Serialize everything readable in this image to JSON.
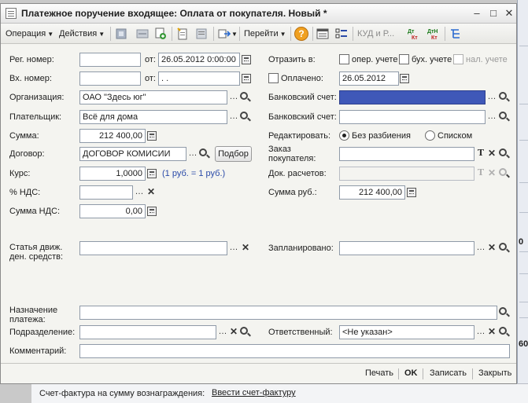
{
  "window": {
    "title": "Платежное поручение входящее: Оплата от покупателя. Новый *",
    "controls": {
      "minimize": "–",
      "maximize": "□",
      "close": "✕"
    }
  },
  "toolbar": {
    "operation": "Операция",
    "actions": "Действия",
    "goto": "Перейти",
    "kud": "КУД и Р...",
    "help": "?"
  },
  "form": {
    "reg_number": {
      "label": "Рег. номер:",
      "value": "",
      "from_label": "от:",
      "date": "26.05.2012  0:00:00"
    },
    "in_number": {
      "label": "Вх. номер:",
      "value": "",
      "from_label": "от:",
      "date": "  .  ."
    },
    "reflect": {
      "label": "Отразить в:",
      "oper": "опер. учете",
      "buh": "бух. учете",
      "nal": "нал. учете"
    },
    "paid": {
      "label": "Оплачено:",
      "date": "26.05.2012"
    },
    "organization": {
      "label": "Организация:",
      "value": "ОАО \"Здесь юг\""
    },
    "bank_account_1": {
      "label": "Банковский счет:",
      "value": ""
    },
    "payer": {
      "label": "Плательщик:",
      "value": "Всё для дома"
    },
    "bank_account_2": {
      "label": "Банковский счет:",
      "value": ""
    },
    "sum": {
      "label": "Сумма:",
      "value": "212 400,00"
    },
    "edit": {
      "label": "Редактировать:",
      "opt1": "Без разбиения",
      "opt2": "Списком"
    },
    "contract": {
      "label": "Договор:",
      "value": "ДОГОВОР КОМИСИИ",
      "select_button": "Подбор"
    },
    "order": {
      "label_line1": "Заказ",
      "label_line2": "покупателя:",
      "value": ""
    },
    "rate": {
      "label": "Курс:",
      "value": "1,0000",
      "hint": "(1 руб. = 1 руб.)"
    },
    "settlement_doc": {
      "label": "Док. расчетов:",
      "value": ""
    },
    "vat_percent": {
      "label": "% НДС:",
      "value": ""
    },
    "sum_rub": {
      "label": "Сумма руб.:",
      "value": "212 400,00"
    },
    "vat_sum": {
      "label": "Сумма НДС:",
      "value": "0,00"
    },
    "cashflow": {
      "label_line1": "Статья движ.",
      "label_line2": "ден. средств:",
      "value": ""
    },
    "planned": {
      "label": "Запланировано:",
      "value": ""
    },
    "purpose": {
      "label_line1": "Назначение",
      "label_line2": "платежа:",
      "value": ""
    },
    "department": {
      "label": "Подразделение:",
      "value": ""
    },
    "responsible": {
      "label": "Ответственный:",
      "value": "<Не указан>"
    },
    "comment": {
      "label": "Комментарий:",
      "value": ""
    }
  },
  "buttons": {
    "print": "Печать",
    "ok": "OK",
    "save": "Записать",
    "close": "Закрыть"
  },
  "status_strip": {
    "text": "Счет-фактура на сумму вознаграждения:",
    "link": "Ввести счет-фактуру"
  },
  "background_window": {
    "fragment_1": "0",
    "fragment_2": "60"
  },
  "colors": {
    "selected_field": "#3f58b8",
    "hint_text": "#2a4aa8",
    "window_bg": "#f4f4f0"
  }
}
